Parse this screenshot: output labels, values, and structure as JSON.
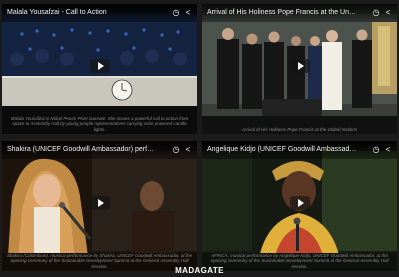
{
  "tiles": [
    {
      "title": "Malala Yousafzai - Call to Action",
      "caption": "Malala Yousafzai is Nobel Peace Prize laureate. She issues a powerful call to action from space to Assembly Hall by young people representatives carrying solar powered candle lights."
    },
    {
      "title": "Arrival of His Holiness Pope Francis at the United Nations",
      "caption": "Arrival of His Holiness Pope Francis at the United Nations"
    },
    {
      "title": "Shakira (UNICEF Goodwill Ambassador) performing Imagine",
      "caption": "Shakira (Colombian), musical performance by Shakira, UNICEF Goodwill Ambassador, at the opening ceremony of the Sustainable Development Summit at the General Assembly Hall session."
    },
    {
      "title": "Angelique Kidjo (UNICEF Goodwill Ambassador) performing",
      "caption": "AFRICA, musical performance by Angelique Kidjo, UNICEF Goodwill Ambassador, at the opening ceremony of the Sustainable Development Summit at the General Assembly Hall session."
    }
  ],
  "footer": {
    "label": "MADAGATE"
  }
}
